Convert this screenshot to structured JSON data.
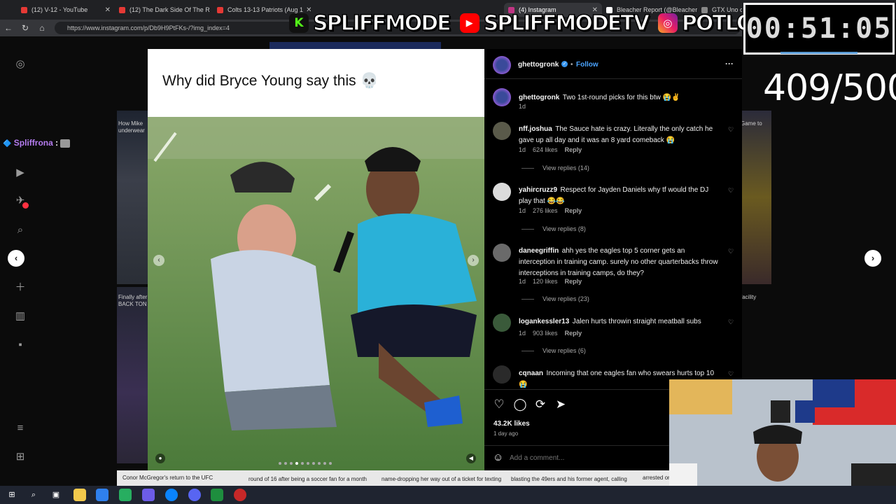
{
  "browser": {
    "tabs": [
      {
        "label": "(12) V-12 - YouTube",
        "color": "#e53935"
      },
      {
        "label": "(12) The Dark Side Of The R",
        "color": "#e53935"
      },
      {
        "label": "Colts 13-13 Patriots (Aug 1",
        "color": "#e53935"
      },
      {
        "label": "(4) Instagram",
        "color": "#c13584"
      },
      {
        "label": "Bleacher Report (@Bleacher",
        "color": "#ffffff"
      },
      {
        "label": "GTX Uno on",
        "color": "#888888"
      }
    ],
    "url": "https://www.instagram.com/p/Db9H9PtFKs-/?img_index=4"
  },
  "overlay": {
    "brand1": "SPLIFFMODE",
    "brand2": "SPLIFFMODETV",
    "brand3": "POTLORD",
    "timer": "00:51:05",
    "counter": "409/500",
    "chat_user": "Spliffrona",
    "chat_sep": ":"
  },
  "background": {
    "tile_left_top": "How Mike underwear",
    "tile_left_mid": "Finally after BACK TON",
    "tile_right_top": "Game to",
    "tile_right_mid": "facility",
    "strip1": "Conor McGregor's return to the UFC",
    "strip2": "round of 16 after being a soccer fan for a month",
    "strip3": "name-dropping her way out of a ticket for texting",
    "strip4": "blasting the 49ers and his former agent, calling",
    "strip5": "arrested or"
  },
  "post": {
    "caption": "Why did Bryce Young say this 💀",
    "author": "ghettogronk",
    "follow": "Follow",
    "more": "···",
    "author_comment": {
      "user": "ghettogronk",
      "text": "Two 1st-round picks for this btw 😭✌️",
      "time": "1d"
    },
    "comments": [
      {
        "user": "nff.joshua",
        "text": "The Sauce hate is crazy. Literally the only catch he gave up all day and it was an 8 yard comeback 😭",
        "time": "1d",
        "likes": "624 likes",
        "reply": "Reply",
        "replies": "View replies (14)"
      },
      {
        "user": "yahircruzz9",
        "text": "Respect for Jayden Daniels why tf would the DJ play that 😂😂",
        "time": "1d",
        "likes": "276 likes",
        "reply": "Reply",
        "replies": "View replies (8)"
      },
      {
        "user": "daneegriffin",
        "text": "ahh yes the eagles top 5 corner gets an interception in training camp. surely no other quarterbacks throw interceptions in training camps, do they?",
        "time": "1d",
        "likes": "120 likes",
        "reply": "Reply",
        "replies": "View replies (23)"
      },
      {
        "user": "logankessler13",
        "text": "Jalen hurts throwin straight meatball subs",
        "time": "1d",
        "likes": "903 likes",
        "reply": "Reply",
        "replies": "View replies (6)"
      },
      {
        "user": "cqnaan",
        "text": "Incoming that one eagles fan who swears hurts top 10 😭",
        "time": "",
        "likes": "",
        "reply": "",
        "replies": ""
      }
    ],
    "likes": "43.2K likes",
    "date": "1 day ago",
    "add_comment_placeholder": "Add a comment..."
  }
}
